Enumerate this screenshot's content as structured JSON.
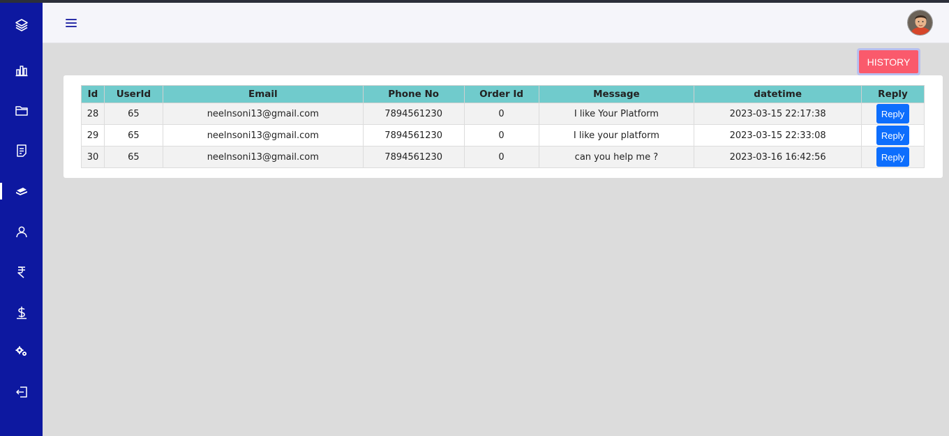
{
  "sidebar": {
    "items": [
      {
        "name": "sidebar-item-dashboard",
        "icon": "layers-icon",
        "active": false
      },
      {
        "name": "sidebar-item-analytics",
        "icon": "bar-chart-icon",
        "active": false
      },
      {
        "name": "sidebar-item-files",
        "icon": "folder-icon",
        "active": false
      },
      {
        "name": "sidebar-item-documents",
        "icon": "document-icon",
        "active": false
      },
      {
        "name": "sidebar-item-messages",
        "icon": "messages-icon",
        "active": true
      },
      {
        "name": "sidebar-item-users",
        "icon": "user-icon",
        "active": false
      },
      {
        "name": "sidebar-item-rupee",
        "icon": "rupee-icon",
        "active": false
      },
      {
        "name": "sidebar-item-dollar",
        "icon": "dollar-icon",
        "active": false
      },
      {
        "name": "sidebar-item-settings",
        "icon": "gears-icon",
        "active": false
      },
      {
        "name": "sidebar-item-logout",
        "icon": "logout-icon",
        "active": false
      }
    ]
  },
  "header": {
    "menu_icon": "hamburger-icon",
    "avatar_icon": "avatar"
  },
  "history_label": "HISTORY",
  "table": {
    "headers": [
      "Id",
      "UserId",
      "Email",
      "Phone No",
      "Order Id",
      "Message",
      "datetime",
      "Reply"
    ],
    "rows": [
      {
        "id": "28",
        "user_id": "65",
        "email": "neelnsoni13@gmail.com",
        "phone": "7894561230",
        "order_id": "0",
        "message": "I like Your Platform",
        "datetime": "2023-03-15 22:17:38",
        "reply": "Reply"
      },
      {
        "id": "29",
        "user_id": "65",
        "email": "neelnsoni13@gmail.com",
        "phone": "7894561230",
        "order_id": "0",
        "message": "I like your platform",
        "datetime": "2023-03-15 22:33:08",
        "reply": "Reply"
      },
      {
        "id": "30",
        "user_id": "65",
        "email": "neelnsoni13@gmail.com",
        "phone": "7894561230",
        "order_id": "0",
        "message": "can you help me ?",
        "datetime": "2023-03-16 16:42:56",
        "reply": "Reply"
      }
    ]
  },
  "colors": {
    "sidebar": "#0d18a0",
    "header_bg": "#f5f5fa",
    "page_bg": "#dcdcdc",
    "history_button": "#fa5a6c",
    "table_header": "#70cbcc",
    "reply_button": "#0d6efd"
  }
}
